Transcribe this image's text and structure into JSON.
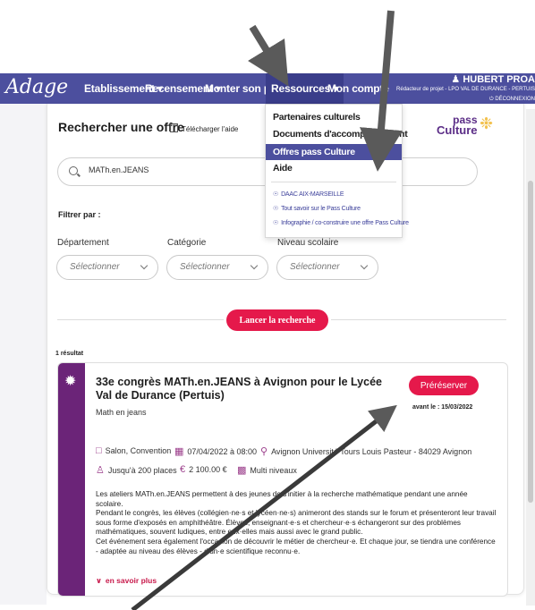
{
  "navbar": {
    "brand": "Adage",
    "items": [
      {
        "label": "Etablissement ▾"
      },
      {
        "label": "Recensement ▾"
      },
      {
        "label": "Monter son projet"
      },
      {
        "label": "Ressources ▾"
      },
      {
        "label": "Mon compte"
      }
    ],
    "user_name": "HUBERT PROA",
    "user_role": "Rédacteur de projet - LPO VAL DE DURANCE - PERTUIS",
    "logout": "DÉCONNEXION"
  },
  "dropdown": {
    "items": [
      "Partenaires culturels",
      "Documents d'accompagnement",
      "Offres pass Culture",
      "Aide"
    ],
    "highlighted_index": 2,
    "links": [
      "DAAC AIX-MARSEILLE",
      "Tout savoir sur le Pass Culture",
      "Infographie / co-construire une offre Pass Culture"
    ]
  },
  "header": {
    "title": "Rechercher une offre",
    "download": "Télécharger l'aide",
    "logo_top": "pass",
    "logo_bottom": "Culture"
  },
  "search": {
    "value": "MATh.en.JEANS"
  },
  "filters": {
    "label": "Filtrer par :",
    "dropdowns": [
      {
        "label": "Département",
        "placeholder": "Sélectionner"
      },
      {
        "label": "Catégorie",
        "placeholder": "Sélectionner"
      },
      {
        "label": "Niveau scolaire",
        "placeholder": "Sélectionner"
      }
    ],
    "search_button": "Lancer la recherche"
  },
  "results_count": "1 résultat",
  "offer": {
    "title": "33e congrès MATh.en.JEANS à Avignon pour le Lycée Val de Durance (Pertuis)",
    "organizer": "Math en jeans",
    "button": "Préréserver",
    "deadline": "avant le : 15/03/2022",
    "category": "Salon, Convention",
    "date": "07/04/2022 à 08:00",
    "location": "Avignon Université Tours Louis Pasteur - 84029 Avignon",
    "places": "Jusqu'à 200 places",
    "price": "2 100.00 €",
    "level": "Multi niveaux",
    "description": [
      "Les ateliers MATh.en.JEANS permettent à des jeunes de s'initier à la recherche mathématique pendant une année scolaire.",
      "Pendant le congrès, les élèves (collégien·ne·s et lycéen·ne·s) animeront des stands sur le forum et présenteront leur travail sous forme d'exposés en amphithéâtre. Élèves, enseignant·e·s et chercheur·e·s échangeront sur des problèmes mathématiques, souvent ludiques, entre eux·elles mais aussi avec le grand public.",
      "Cet événement sera également l'occasion de découvrir le métier de chercheur·e. Et chaque jour, se tiendra une conférence - adaptée au niveau des élèves - d'un·e scientifique reconnu·e."
    ],
    "more": "en savoir plus"
  },
  "colors": {
    "nav": "#4c4f9e",
    "accent": "#e5194b",
    "stripe": "#6b2478"
  }
}
